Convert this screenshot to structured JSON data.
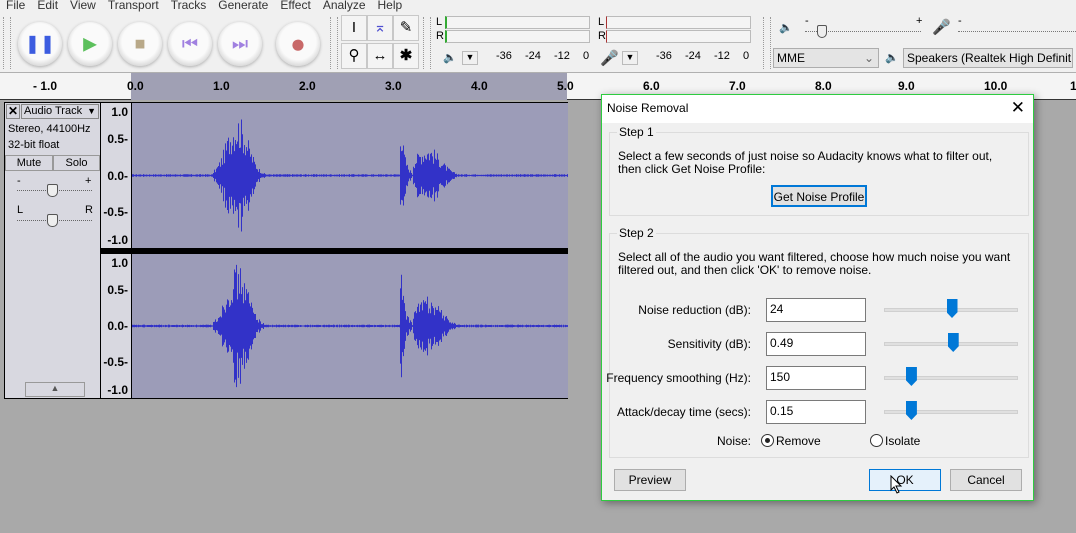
{
  "menu": [
    "File",
    "Edit",
    "View",
    "Transport",
    "Tracks",
    "Generate",
    "Effect",
    "Analyze",
    "Help"
  ],
  "transport": [
    {
      "name": "pause",
      "color": "#3c5ce0"
    },
    {
      "name": "play",
      "color": "#5cc05c"
    },
    {
      "name": "stop",
      "color": "#b8a888"
    },
    {
      "name": "skip-start",
      "color": "#a080e0"
    },
    {
      "name": "skip-end",
      "color": "#a080e0"
    },
    {
      "name": "record",
      "color": "#c86868"
    }
  ],
  "meters": {
    "L": "L",
    "R": "R",
    "scale_play": [
      "-36",
      "-24",
      "-12",
      "0"
    ],
    "scale_rec": [
      "-36",
      "-24",
      "-12",
      "0"
    ]
  },
  "mixer": {
    "minus": "-",
    "plus": "+"
  },
  "device": {
    "host": "MME",
    "output": "Speakers (Realtek High Definit"
  },
  "ruler": [
    "- 1.0",
    "0.0",
    "1.0",
    "2.0",
    "3.0",
    "4.0",
    "5.0",
    "6.0",
    "7.0",
    "8.0",
    "9.0",
    "10.0",
    "1"
  ],
  "track": {
    "name": "Audio Track",
    "info1": "Stereo, 44100Hz",
    "info2": "32-bit float",
    "mute": "Mute",
    "solo": "Solo",
    "gain_minus": "-",
    "gain_plus": "+",
    "pan_l": "L",
    "pan_r": "R",
    "scale": [
      "1.0",
      "0.5-",
      "0.0-",
      "-0.5-",
      "-1.0"
    ]
  },
  "dialog": {
    "title": "Noise Removal",
    "step1": {
      "label": "Step 1",
      "text1": "Select a few seconds of just noise so Audacity knows what to filter out,",
      "text2": "then click Get Noise Profile:",
      "button": "Get Noise Profile"
    },
    "step2": {
      "label": "Step 2",
      "text1": "Select all of the audio you want filtered, choose how much noise you want",
      "text2": "filtered out, and then click 'OK' to remove noise."
    },
    "fields": [
      {
        "label": "Noise reduction (dB):",
        "value": "24",
        "slider_fraction": 0.5
      },
      {
        "label": "Sensitivity (dB):",
        "value": "0.49",
        "slider_fraction": 0.51
      },
      {
        "label": "Frequency smoothing (Hz):",
        "value": "150",
        "slider_fraction": 0.17
      },
      {
        "label": "Attack/decay time (secs):",
        "value": "0.15",
        "slider_fraction": 0.17
      }
    ],
    "noise_label": "Noise:",
    "remove": "Remove",
    "isolate": "Isolate",
    "selected": "Remove",
    "preview": "Preview",
    "ok": "OK",
    "cancel": "Cancel"
  },
  "colors": {
    "accent": "#0078d7",
    "waveform": "#3232c8",
    "selection": "#9c9cb8"
  }
}
